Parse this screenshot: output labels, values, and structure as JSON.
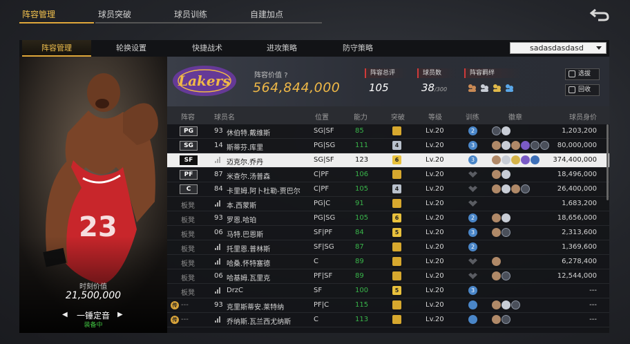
{
  "top_tabs": [
    "阵容管理",
    "球员突破",
    "球员训练",
    "自建加点"
  ],
  "sub_tabs": [
    "阵容管理",
    "轮换设置",
    "快捷战术",
    "进攻策略",
    "防守策略"
  ],
  "lineup_dropdown": "sadasdasdasd",
  "player_card": {
    "market_value_label": "时刻价值",
    "market_value": "21,500,000",
    "name": "一锤定音",
    "status": "装备中"
  },
  "summary": {
    "team_value_label": "阵容价值",
    "team_value": "564,844,000",
    "rating_label": "阵容总评",
    "rating": "105",
    "players_label": "球员数",
    "players_count": "38",
    "players_max": "/300",
    "bond_label": "阵容羁绊",
    "btn_select": "选拔",
    "btn_recycle": "回收"
  },
  "table": {
    "headers": {
      "lineup": "阵容",
      "name": "球员名",
      "position": "位置",
      "ability": "能力",
      "breakthrough": "突破",
      "level": "等级",
      "training": "训练",
      "badges": "徽章",
      "value": "球员身价"
    },
    "rows": [
      {
        "slot": "PG",
        "num": "93",
        "name": "休伯特.戴维斯",
        "pos": "SG|SF",
        "ovr": "85",
        "brk": "",
        "brkType": "crown",
        "lv": "Lv.20",
        "trn": "2",
        "trnType": "blue",
        "badges": [
          "b-dk",
          "b-sv"
        ],
        "value": "1,203,200"
      },
      {
        "slot": "SG",
        "num": "14",
        "name": "斯蒂芬.库里",
        "pos": "PG|SG",
        "ovr": "111",
        "brk": "4",
        "brkType": "silver",
        "lv": "Lv.20",
        "trn": "3",
        "trnType": "blue",
        "badges": [
          "b-br",
          "b-sv",
          "b-br",
          "b-pu",
          "b-dk",
          "b-dk"
        ],
        "value": "80,000,000"
      },
      {
        "slot": "SF",
        "num": "",
        "name": "迈克尔.乔丹",
        "pos": "SG|SF",
        "ovr": "123",
        "brk": "6",
        "brkType": "gold",
        "lv": "Lv.20",
        "trn": "3",
        "trnType": "blue",
        "badges": [
          "b-br",
          "b-sv",
          "b-gd",
          "b-pu",
          "b-bl"
        ],
        "value": "374,400,000",
        "selected": true
      },
      {
        "slot": "PF",
        "num": "87",
        "name": "米查尔.汤普森",
        "pos": "C|PF",
        "ovr": "106",
        "brk": "",
        "brkType": "crown",
        "lv": "Lv.20",
        "trn": "",
        "trnType": "gray",
        "badges": [
          "b-br",
          "b-sv"
        ],
        "value": "18,496,000"
      },
      {
        "slot": "C",
        "num": "84",
        "name": "卡里姆.阿卜杜勒-贾巴尔",
        "pos": "C|PF",
        "ovr": "105",
        "brk": "4",
        "brkType": "silver",
        "lv": "Lv.20",
        "trn": "",
        "trnType": "gray",
        "badges": [
          "b-br",
          "b-sv",
          "b-br",
          "b-dk"
        ],
        "value": "26,400,000"
      },
      {
        "slot": "板凳",
        "num": "",
        "name": "本.西蒙斯",
        "pos": "PG|C",
        "ovr": "91",
        "brk": "",
        "brkType": "crown",
        "lv": "Lv.20",
        "trn": "",
        "trnType": "gray",
        "badges": [],
        "value": "1,683,200"
      },
      {
        "slot": "板凳",
        "num": "93",
        "name": "罗恩.哈珀",
        "pos": "PG|SG",
        "ovr": "105",
        "brk": "6",
        "brkType": "gold",
        "lv": "Lv.20",
        "trn": "2",
        "trnType": "blue",
        "badges": [
          "b-br",
          "b-sv"
        ],
        "value": "18,656,000"
      },
      {
        "slot": "板凳",
        "num": "06",
        "name": "马特.巴恩斯",
        "pos": "SF|PF",
        "ovr": "84",
        "brk": "5",
        "brkType": "gold",
        "lv": "Lv.20",
        "trn": "3",
        "trnType": "blue",
        "badges": [
          "b-br",
          "b-dk"
        ],
        "value": "2,313,600"
      },
      {
        "slot": "板凳",
        "num": "",
        "name": "托里恩.普林斯",
        "pos": "SF|SG",
        "ovr": "87",
        "brk": "",
        "brkType": "crown",
        "lv": "Lv.20",
        "trn": "2",
        "trnType": "blue",
        "badges": [],
        "value": "1,369,600"
      },
      {
        "slot": "板凳",
        "num": "",
        "name": "哈桑.怀特塞德",
        "pos": "C",
        "ovr": "89",
        "brk": "",
        "brkType": "crown",
        "lv": "Lv.20",
        "trn": "",
        "trnType": "gray",
        "badges": [
          "b-br"
        ],
        "value": "6,278,400"
      },
      {
        "slot": "板凳",
        "num": "06",
        "name": "哈基姆.瓦里克",
        "pos": "PF|SF",
        "ovr": "89",
        "brk": "",
        "brkType": "crown",
        "lv": "Lv.20",
        "trn": "",
        "trnType": "gray",
        "badges": [
          "b-br",
          "b-dk"
        ],
        "value": "12,544,000"
      },
      {
        "slot": "板凳",
        "num": "",
        "name": "DrzC",
        "pos": "SF",
        "ovr": "100",
        "brk": "5",
        "brkType": "gold",
        "lv": "Lv.20",
        "trn": "3",
        "trnType": "blue",
        "badges": [],
        "value": "---"
      },
      {
        "slot": "---",
        "num": "93",
        "name": "克里斯蒂安.莱特纳",
        "pos": "PF|C",
        "ovr": "115",
        "brk": "",
        "brkType": "crown",
        "lv": "Lv.20",
        "trn": "",
        "trnType": "blue",
        "badges": [
          "b-br",
          "b-sv",
          "b-dk"
        ],
        "value": "---",
        "legend": true
      },
      {
        "slot": "---",
        "num": "",
        "name": "乔纳斯.瓦兰西尤纳斯",
        "pos": "C",
        "ovr": "113",
        "brk": "",
        "brkType": "crown",
        "lv": "Lv.20",
        "trn": "",
        "trnType": "blue",
        "badges": [
          "b-br",
          "b-dk"
        ],
        "value": "---",
        "legend": true
      }
    ]
  }
}
